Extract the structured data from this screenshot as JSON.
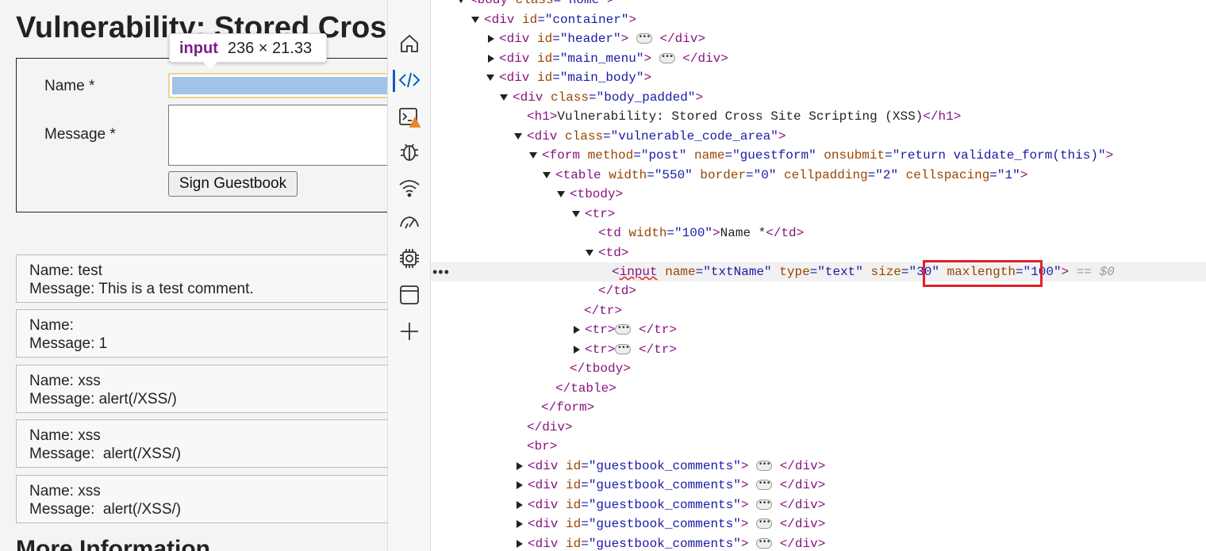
{
  "page": {
    "title": "Vulnerability: Stored Cross Site Scripting (XSS)",
    "form": {
      "name_label": "Name *",
      "message_label": "Message *",
      "sign_button": "Sign Guestbook"
    },
    "comments": [
      {
        "name": "Name: test",
        "message": "Message: This is a test comment."
      },
      {
        "name": "Name:",
        "message": "Message: 1"
      },
      {
        "name": "Name: xss",
        "message": "Message: alert(/XSS/)"
      },
      {
        "name": "Name: xss",
        "message": "Message:  alert(/XSS/)"
      },
      {
        "name": "Name: xss",
        "message": "Message:  alert(/XSS/)"
      }
    ],
    "more_info": "More Information"
  },
  "tooltip": {
    "tag": "input",
    "dims": "236 × 21.33"
  },
  "activity_bar": {
    "items": [
      "home-icon",
      "elements-icon",
      "console-icon",
      "sources-icon",
      "network-icon",
      "performance-icon",
      "memory-icon",
      "application-icon",
      "add-tool-icon"
    ],
    "active": "elements-icon",
    "accent": "#0a5fc5"
  },
  "dom": {
    "l0": {
      "t1": "<body",
      "a1": " class",
      "v1": "=\"home\"",
      "t2": ">"
    },
    "l1": {
      "t1": "<div",
      "a1": " id",
      "v1": "=\"container\"",
      "t2": ">"
    },
    "l2": {
      "t1": "<div",
      "a1": " id",
      "v1": "=\"header\"",
      "t2": ">",
      "t3": "</div>"
    },
    "l3": {
      "t1": "<div",
      "a1": " id",
      "v1": "=\"main_menu\"",
      "t2": ">",
      "t3": "</div>"
    },
    "l4": {
      "t1": "<div",
      "a1": " id",
      "v1": "=\"main_body\"",
      "t2": ">"
    },
    "l5": {
      "t1": "<div",
      "a1": " class",
      "v1": "=\"body_padded\"",
      "t2": ">"
    },
    "l6": {
      "t1": "<h1>",
      "x": "Vulnerability: Stored Cross Site Scripting (XSS)",
      "t2": "</h1>"
    },
    "l7": {
      "t1": "<div",
      "a1": " class",
      "v1": "=\"vulnerable_code_area\"",
      "t2": ">"
    },
    "l8": {
      "t1": "<form",
      "a1": " method",
      "v1": "=\"post\"",
      "a2": " name",
      "v2": "=\"guestform\"",
      "a3": " onsubmit",
      "v3": "=\"return validate_form(this)\"",
      "t2": ">"
    },
    "l9": {
      "t1": "<table",
      "a1": " width",
      "v1": "=\"550\"",
      "a2": " border",
      "v2": "=\"0\"",
      "a3": " cellpadding",
      "v3": "=\"2\"",
      "a4": " cellspacing",
      "v4": "=\"1\"",
      "t2": ">"
    },
    "l10": {
      "t1": "<tbody>"
    },
    "l11": {
      "t1": "<tr>"
    },
    "l12": {
      "t1": "<td",
      "a1": " width",
      "v1": "=\"100\"",
      "t2": ">",
      "x": "Name *",
      "t3": "</td>"
    },
    "l13": {
      "t1": "<td>"
    },
    "l14": {
      "t0": "<",
      "t1": "input",
      "a1": " name",
      "v1": "=\"txtName\"",
      "a2": " type",
      "v2": "=\"text\"",
      "a3": " size",
      "v3": "=\"30\"",
      "a4": " maxlength",
      "v4": "=\"100\"",
      "t2": ">",
      "dollar": " == $0"
    },
    "l15": {
      "t1": "</td>"
    },
    "l16": {
      "t1": "</tr>"
    },
    "l17": {
      "t1": "<tr>",
      "t2": "</tr>"
    },
    "l18": {
      "t1": "<tr>",
      "t2": "</tr>"
    },
    "l19": {
      "t1": "</tbody>"
    },
    "l20": {
      "t1": "</table>"
    },
    "l21": {
      "t1": "</form>"
    },
    "l22": {
      "t1": "</div>"
    },
    "l23": {
      "t1": "<br>"
    },
    "gb": {
      "t1": "<div",
      "a1": " id",
      "v1": "=\"guestbook_comments\"",
      "t2": ">",
      "t3": "</div>"
    },
    "ellipsis": "•••",
    "gutter_dots": "•••"
  },
  "highlight_color": "#e0222a"
}
